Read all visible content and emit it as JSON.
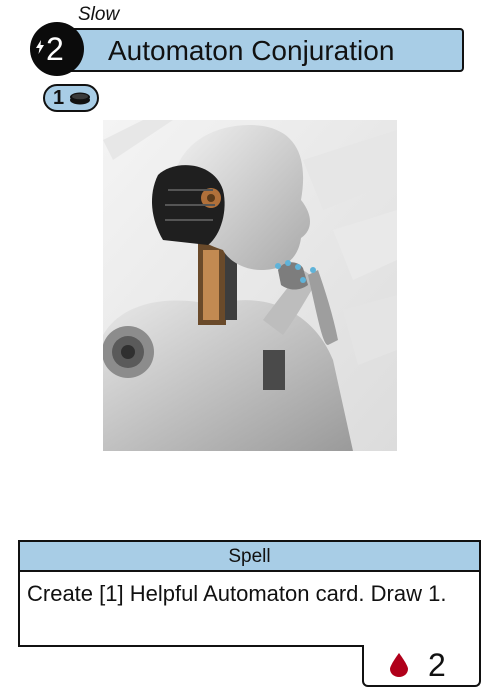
{
  "card": {
    "speed": "Slow",
    "cost": "2",
    "title": "Automaton Conjuration",
    "sub_cost": "1",
    "type": "Spell",
    "rules_text": "Create [1] Helpful Automaton card. Draw 1.",
    "blood_value": "2"
  },
  "icons": {
    "cost": "lightning-bolt-icon",
    "sub_cost": "token-icon",
    "blood": "blood-drop-icon"
  },
  "colors": {
    "accent": "#a8cde6",
    "cost_circle": "#0b0b0b",
    "blood": "#b0001a"
  }
}
